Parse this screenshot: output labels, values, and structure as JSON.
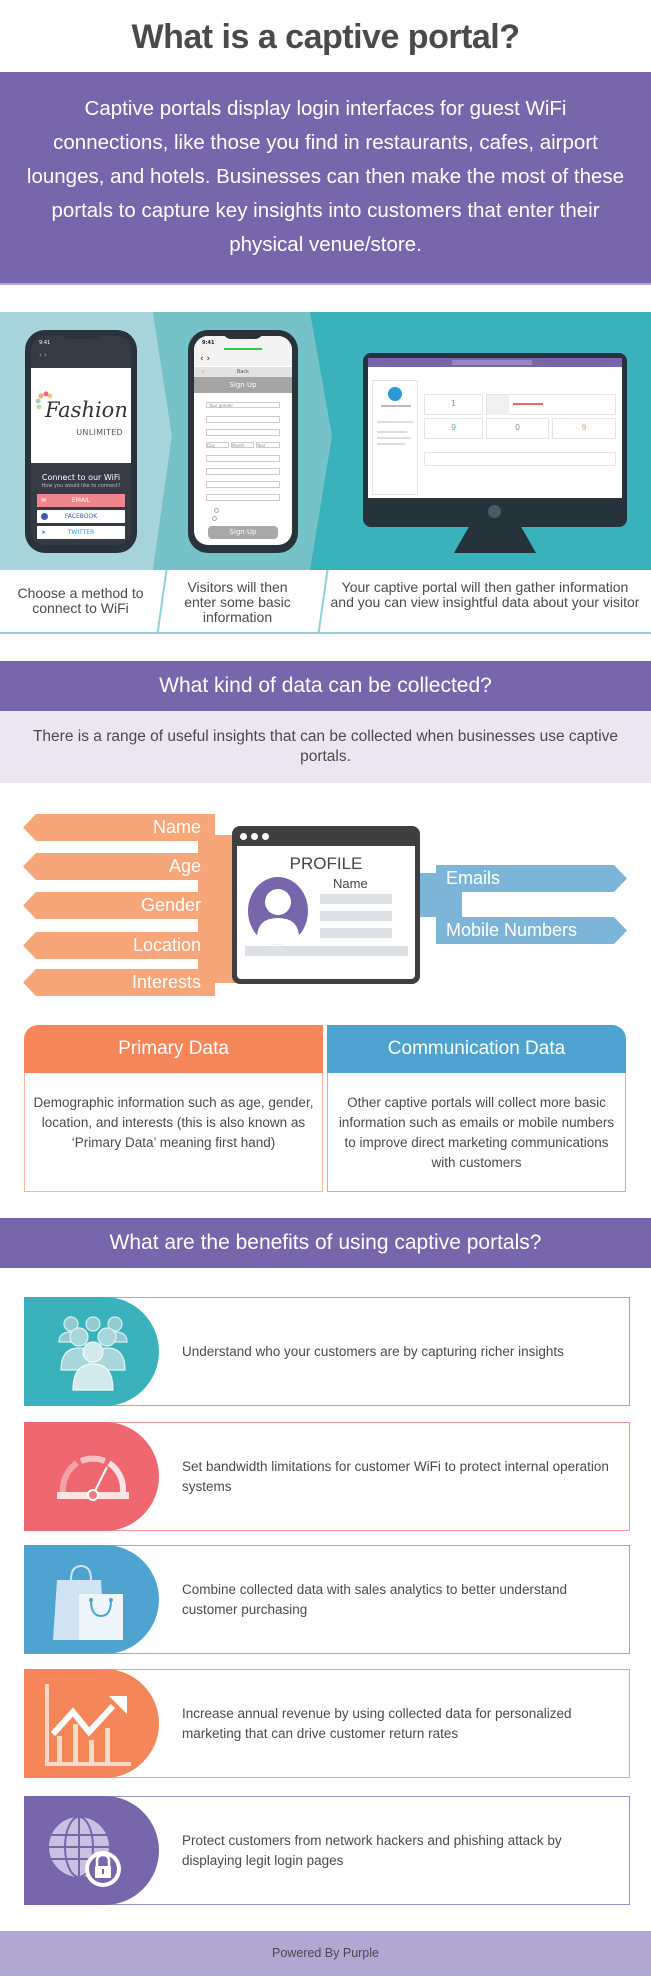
{
  "title": "What is a captive portal?",
  "intro": "Captive portals display login interfaces for guest WiFi connections, like those you find in restaurants, cafes, airport lounges, and hotels. Businesses can then make the most of these portals to capture key insights into customers that enter their physical venue/store.",
  "colors": {
    "purple": "#7766ab",
    "light_purple": "#b0a7d3",
    "teal": "#39b2bb",
    "orange": "#f5865a",
    "orange_light": "#f6a678",
    "blue": "#4fa3d1",
    "blue_light": "#7db5d8",
    "red": "#ef6870"
  },
  "steps": [
    {
      "caption": "Choose a method to connect to WiFi",
      "phone": {
        "time": "9:41",
        "brand": "Fashion",
        "brand_sub": "UNLIMITED",
        "heading": "Connect to our WiFi",
        "subheading": "How you would like to connect?",
        "buttons": [
          "EMAIL",
          "FACEBOOK",
          "TWITTER"
        ]
      }
    },
    {
      "caption": "Visitors will then enter some basic information",
      "phone": {
        "time": "9:41",
        "back_label": "Back",
        "form_title": "Sign Up",
        "select_placeholder": "Your gender",
        "date_fields": [
          "Day",
          "Month",
          "Year"
        ],
        "submit_label": "Sign Up"
      }
    },
    {
      "caption": "Your captive portal will then gather information and you can view insightful data about your visitor",
      "dashboard": {
        "stats": [
          {
            "value": "1",
            "color": "#ef6870"
          },
          {
            "value": "9",
            "color": "#5bbf7a"
          },
          {
            "value": "0",
            "color": "#8a80bd"
          },
          {
            "value": "9",
            "color": "#f5a05a"
          }
        ]
      }
    }
  ],
  "data_section": {
    "heading": "What kind of data can be collected?",
    "subtext": "There is a range of useful insights that can be collected when businesses use captive portals.",
    "primary_tags": [
      "Name",
      "Age",
      "Gender",
      "Location",
      "Interests"
    ],
    "communication_tags": [
      "Emails",
      "Mobile Numbers"
    ],
    "profile": {
      "title": "PROFILE",
      "name_label": "Name"
    },
    "cards": [
      {
        "title": "Primary Data",
        "text": "Demographic information such as age, gender, location, and interests (this is also known as ‘Primary Data’ meaning first hand)"
      },
      {
        "title": "Communication Data",
        "text": "Other captive portals will collect more basic information such as emails or mobile numbers to improve direct marketing communications with customers"
      }
    ]
  },
  "benefits_section": {
    "heading": "What are the benefits of using captive portals?",
    "items": [
      {
        "icon": "customers-group-icon",
        "text": "Understand who your customers are by capturing richer insights"
      },
      {
        "icon": "speedometer-icon",
        "text": "Set bandwidth limitations for customer WiFi to protect internal operation systems"
      },
      {
        "icon": "shopping-bags-icon",
        "text": "Combine collected data with sales analytics to better understand customer purchasing"
      },
      {
        "icon": "growth-chart-icon",
        "text": "Increase annual revenue by using collected data for personalized marketing that can drive customer return rates"
      },
      {
        "icon": "globe-lock-icon",
        "text": "Protect customers from network hackers and phishing attack by displaying legit login pages"
      }
    ]
  },
  "footer": "Powered By Purple"
}
